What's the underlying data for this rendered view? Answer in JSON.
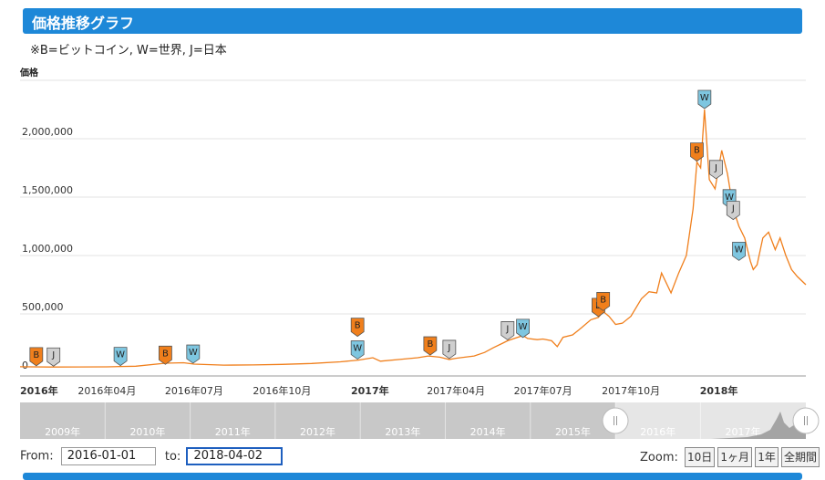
{
  "header": {
    "title": "価格推移グラフ"
  },
  "note": "※B=ビットコイン, W=世界, J=日本",
  "controls": {
    "from_label": "From:",
    "from_value": "2016-01-01",
    "to_label": "to:",
    "to_value": "2018-04-02",
    "zoom_label": "Zoom:",
    "zoom_buttons": [
      "10日",
      "1ヶ月",
      "1年",
      "全期間"
    ]
  },
  "chart_data": {
    "type": "line",
    "ylabel": "価格",
    "ylim": [
      0,
      2500000
    ],
    "yticks": [
      0,
      500000,
      1000000,
      1500000,
      2000000
    ],
    "ytick_labels": [
      "0",
      "500,000",
      "1,000,000",
      "1,500,000",
      "2,000,000"
    ],
    "xticks": [
      {
        "date": "2016-01-01",
        "label": "2016年",
        "bold": true
      },
      {
        "date": "2016-04-01",
        "label": "2016年04月",
        "bold": false
      },
      {
        "date": "2016-07-01",
        "label": "2016年07月",
        "bold": false
      },
      {
        "date": "2016-10-01",
        "label": "2016年10月",
        "bold": false
      },
      {
        "date": "2017-01-01",
        "label": "2017年",
        "bold": true
      },
      {
        "date": "2017-04-01",
        "label": "2017年04月",
        "bold": false
      },
      {
        "date": "2017-07-01",
        "label": "2017年07月",
        "bold": false
      },
      {
        "date": "2017-10-01",
        "label": "2017年10月",
        "bold": false
      },
      {
        "date": "2018-01-01",
        "label": "2018年",
        "bold": true
      }
    ],
    "xlim": [
      "2016-01-01",
      "2018-04-02"
    ],
    "series": [
      {
        "color": "#f07f1c",
        "points": [
          [
            "2016-01-01",
            48000
          ],
          [
            "2016-02-01",
            45000
          ],
          [
            "2016-03-01",
            46000
          ],
          [
            "2016-04-01",
            47000
          ],
          [
            "2016-05-01",
            52000
          ],
          [
            "2016-06-01",
            78000
          ],
          [
            "2016-06-20",
            82000
          ],
          [
            "2016-07-01",
            70000
          ],
          [
            "2016-08-01",
            62000
          ],
          [
            "2016-09-01",
            63000
          ],
          [
            "2016-10-01",
            68000
          ],
          [
            "2016-11-01",
            76000
          ],
          [
            "2016-12-01",
            90000
          ],
          [
            "2016-12-20",
            105000
          ],
          [
            "2017-01-04",
            125000
          ],
          [
            "2017-01-12",
            95000
          ],
          [
            "2017-02-01",
            110000
          ],
          [
            "2017-02-20",
            125000
          ],
          [
            "2017-03-03",
            140000
          ],
          [
            "2017-03-15",
            130000
          ],
          [
            "2017-03-25",
            110000
          ],
          [
            "2017-04-01",
            120000
          ],
          [
            "2017-04-20",
            140000
          ],
          [
            "2017-05-01",
            170000
          ],
          [
            "2017-05-10",
            210000
          ],
          [
            "2017-05-20",
            250000
          ],
          [
            "2017-05-25",
            270000
          ],
          [
            "2017-06-01",
            290000
          ],
          [
            "2017-06-10",
            315000
          ],
          [
            "2017-06-15",
            290000
          ],
          [
            "2017-06-25",
            280000
          ],
          [
            "2017-07-01",
            285000
          ],
          [
            "2017-07-10",
            270000
          ],
          [
            "2017-07-16",
            220000
          ],
          [
            "2017-07-22",
            300000
          ],
          [
            "2017-08-01",
            320000
          ],
          [
            "2017-08-10",
            380000
          ],
          [
            "2017-08-20",
            450000
          ],
          [
            "2017-08-28",
            470000
          ],
          [
            "2017-09-02",
            520000
          ],
          [
            "2017-09-08",
            480000
          ],
          [
            "2017-09-15",
            410000
          ],
          [
            "2017-09-22",
            420000
          ],
          [
            "2017-10-01",
            480000
          ],
          [
            "2017-10-12",
            630000
          ],
          [
            "2017-10-20",
            690000
          ],
          [
            "2017-10-28",
            680000
          ],
          [
            "2017-11-02",
            850000
          ],
          [
            "2017-11-12",
            680000
          ],
          [
            "2017-11-20",
            850000
          ],
          [
            "2017-11-28",
            1000000
          ],
          [
            "2017-12-05",
            1400000
          ],
          [
            "2017-12-09",
            1800000
          ],
          [
            "2017-12-13",
            1750000
          ],
          [
            "2017-12-17",
            2250000
          ],
          [
            "2017-12-22",
            1650000
          ],
          [
            "2017-12-28",
            1570000
          ],
          [
            "2018-01-04",
            1900000
          ],
          [
            "2018-01-10",
            1700000
          ],
          [
            "2018-01-16",
            1400000
          ],
          [
            "2018-01-22",
            1250000
          ],
          [
            "2018-01-28",
            1150000
          ],
          [
            "2018-02-03",
            950000
          ],
          [
            "2018-02-06",
            880000
          ],
          [
            "2018-02-10",
            920000
          ],
          [
            "2018-02-16",
            1150000
          ],
          [
            "2018-02-22",
            1200000
          ],
          [
            "2018-03-01",
            1050000
          ],
          [
            "2018-03-06",
            1150000
          ],
          [
            "2018-03-12",
            1000000
          ],
          [
            "2018-03-18",
            880000
          ],
          [
            "2018-03-24",
            820000
          ],
          [
            "2018-04-02",
            750000
          ]
        ]
      }
    ],
    "flags": [
      {
        "date": "2016-01-18",
        "value": 48000,
        "label": "B",
        "kind": "B"
      },
      {
        "date": "2016-02-05",
        "value": 45000,
        "label": "J",
        "kind": "J"
      },
      {
        "date": "2016-04-15",
        "value": 50000,
        "label": "W",
        "kind": "W"
      },
      {
        "date": "2016-06-01",
        "value": 60000,
        "label": "B",
        "kind": "B"
      },
      {
        "date": "2016-06-30",
        "value": 70000,
        "label": "W",
        "kind": "W"
      },
      {
        "date": "2016-12-19",
        "value": 300000,
        "label": "B",
        "kind": "B"
      },
      {
        "date": "2016-12-19",
        "value": 105000,
        "label": "W",
        "kind": "W"
      },
      {
        "date": "2017-03-05",
        "value": 140000,
        "label": "B",
        "kind": "B"
      },
      {
        "date": "2017-03-25",
        "value": 110000,
        "label": "J",
        "kind": "J"
      },
      {
        "date": "2017-05-25",
        "value": 270000,
        "label": "J",
        "kind": "J"
      },
      {
        "date": "2017-06-10",
        "value": 290000,
        "label": "W",
        "kind": "W"
      },
      {
        "date": "2017-08-28",
        "value": 470000,
        "label": "B",
        "kind": "B"
      },
      {
        "date": "2017-09-02",
        "value": 520000,
        "label": "B",
        "kind": "B"
      },
      {
        "date": "2017-12-09",
        "value": 1800000,
        "label": "B",
        "kind": "B"
      },
      {
        "date": "2017-12-17",
        "value": 2250000,
        "label": "W",
        "kind": "W"
      },
      {
        "date": "2017-12-29",
        "value": 1650000,
        "label": "J",
        "kind": "J"
      },
      {
        "date": "2018-01-12",
        "value": 1400000,
        "label": "W",
        "kind": "W"
      },
      {
        "date": "2018-01-16",
        "value": 1300000,
        "label": "J",
        "kind": "J"
      },
      {
        "date": "2018-01-22",
        "value": 950000,
        "label": "W",
        "kind": "W"
      }
    ],
    "flag_colors": {
      "B": "#f07f1c",
      "W": "#7ec6e0",
      "J": "#cfcfcf"
    },
    "navigator": {
      "years": [
        "2009年",
        "2010年",
        "2011年",
        "2012年",
        "2013年",
        "2014年",
        "2015年",
        "2016年",
        "2017年"
      ]
    }
  }
}
